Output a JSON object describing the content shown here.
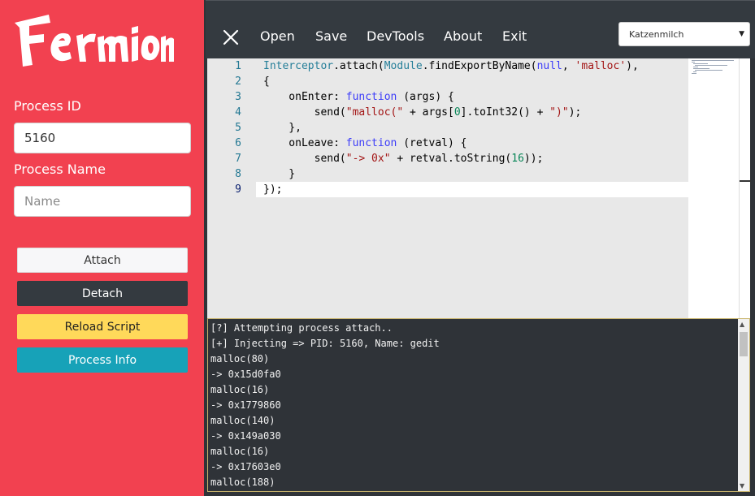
{
  "app": {
    "logo_text": "Fermion"
  },
  "sidebar": {
    "process_id_label": "Process ID",
    "process_id_value": "5160",
    "process_name_label": "Process Name",
    "process_name_placeholder": "Name",
    "buttons": {
      "attach": "Attach",
      "detach": "Detach",
      "reload": "Reload Script",
      "info": "Process Info"
    }
  },
  "topbar": {
    "menu": [
      "Open",
      "Save",
      "DevTools",
      "About",
      "Exit"
    ],
    "theme_select": "Katzenmilch"
  },
  "editor": {
    "line_numbers": [
      "1",
      "2",
      "3",
      "4",
      "5",
      "6",
      "7",
      "8",
      "9"
    ],
    "active_line": 9
  },
  "console": {
    "lines": [
      "[?] Attempting process attach..",
      "[+] Injecting => PID: 5160, Name: gedit",
      "malloc(80)",
      "-> 0x15d0fa0",
      "malloc(16)",
      "-> 0x1779860",
      "malloc(140)",
      "-> 0x149a030",
      "malloc(16)",
      "-> 0x17603e0",
      "malloc(188)"
    ]
  },
  "colors": {
    "sidebar_bg": "#f24150",
    "topbar_bg": "#343a40",
    "editor_bg": "#e8e8e8",
    "console_bg": "#2f3338"
  }
}
